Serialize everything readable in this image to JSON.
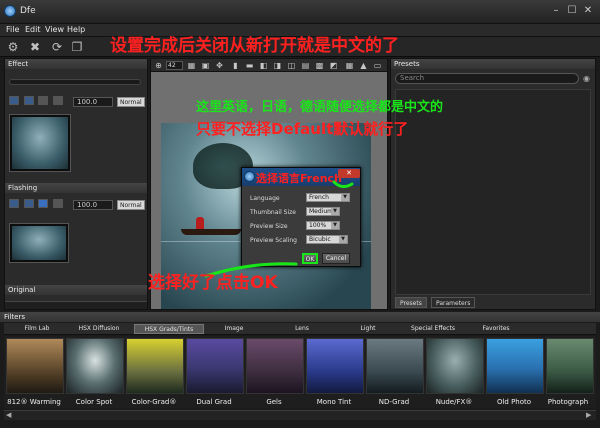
{
  "window": {
    "title": "Dfe"
  },
  "menu": [
    {
      "label": "File"
    },
    {
      "label": "Edit"
    },
    {
      "label": "View"
    },
    {
      "label": "Help"
    }
  ],
  "annotations": {
    "top_red": "设置完成后关闭从新打开就是中文的了",
    "middle_green": "这里英语，日语，德语随便选择都是中文的",
    "middle_red": "只要不选择Default默认就行了",
    "dialog_red": "选择语言French",
    "bottom_red": "选择好了点击OK"
  },
  "left_panel": {
    "effect_header": "Effect",
    "effect_opacity": "100.0",
    "effect_blend": "Normal",
    "flashing_header": "Flashing",
    "flashing_opacity": "100.0",
    "flashing_blend": "Normal",
    "original_header": "Original"
  },
  "center": {
    "zoom": "42"
  },
  "dialog": {
    "language_label": "Language",
    "language_value": "French",
    "thumb_label": "Thumbnail Size",
    "thumb_value": "Medium",
    "preview_label": "Preview Size",
    "preview_value": "100%",
    "scaling_label": "Preview Scaling",
    "scaling_value": "Bicubic",
    "ok_label": "OK",
    "cancel_label": "Cancel"
  },
  "right_panel": {
    "header": "Presets",
    "search_placeholder": "Search",
    "tab_presets": "Presets",
    "tab_parameters": "Parameters"
  },
  "filters": {
    "header": "Filters",
    "tabs": [
      {
        "label": "Film Lab"
      },
      {
        "label": "HSX Diffusion"
      },
      {
        "label": "HSX Grads/Tints"
      },
      {
        "label": "Image"
      },
      {
        "label": "Lens"
      },
      {
        "label": "Light"
      },
      {
        "label": "Special Effects"
      },
      {
        "label": "Favorites"
      }
    ],
    "items": [
      {
        "label": "812® Warming"
      },
      {
        "label": "Color Spot"
      },
      {
        "label": "Color-Grad®"
      },
      {
        "label": "Dual Grad"
      },
      {
        "label": "Gels"
      },
      {
        "label": "Mono Tint"
      },
      {
        "label": "ND-Grad"
      },
      {
        "label": "Nude/FX®"
      },
      {
        "label": "Old Photo"
      },
      {
        "label": "Photograph"
      }
    ]
  },
  "colors": {
    "annotation_red": "#ff2020",
    "annotation_green": "#19e619",
    "accent_blue": "#1f4f8a"
  }
}
